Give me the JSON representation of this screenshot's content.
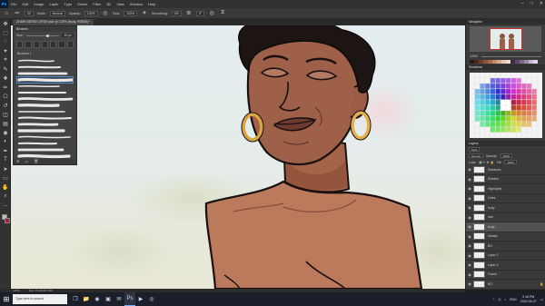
{
  "menubar": {
    "logo": "Ps",
    "items": [
      "File",
      "Edit",
      "Image",
      "Layer",
      "Type",
      "Select",
      "Filter",
      "3D",
      "View",
      "Window",
      "Help"
    ],
    "win_controls": [
      "–",
      "□",
      "✕"
    ]
  },
  "options": {
    "brush_size": "20",
    "mode_label": "Mode:",
    "mode_value": "Normal",
    "opacity_label": "Opacity:",
    "opacity_value": "100%",
    "flow_label": "Flow:",
    "flow_value": "100%",
    "smoothing_label": "Smoothing:",
    "smoothing_value": "0%",
    "angle_value": "0°"
  },
  "document": {
    "tab_title": "ZHARI DEREK ORSH.psd @ 125% (body, RGB/8) *"
  },
  "toolbar": {
    "tools": [
      "move-icon",
      "marquee-icon",
      "lasso-icon",
      "wand-icon",
      "crop-icon",
      "eyedropper-icon",
      "healing-icon",
      "brush-icon",
      "stamp-icon",
      "history-icon",
      "eraser-icon",
      "gradient-icon",
      "blur-icon",
      "dodge-icon",
      "pen-icon",
      "type-icon",
      "path-icon",
      "shape-icon",
      "hand-icon",
      "zoom-icon",
      "more-icon"
    ],
    "glyphs": [
      "✥",
      "⬚",
      "◌",
      "✦",
      "⌗",
      "✎",
      "✚",
      "✏",
      "⎔",
      "↺",
      "◫",
      "▤",
      "◉",
      "◐",
      "✒",
      "T",
      "➤",
      "▭",
      "✋",
      "⌕",
      "…"
    ],
    "fg_color": "#c9c2b4",
    "bg_color": "#a0262a"
  },
  "brushes": {
    "title": "Brushes",
    "size_label": "Size:",
    "size_value": "20 px",
    "folder": "Brushes 1",
    "footer": [
      "⊞",
      "▭",
      "🗑"
    ]
  },
  "navigator": {
    "tab": "Navigator",
    "zoom": "125%"
  },
  "swatches_tab": "Swatches",
  "layers": {
    "tab": "Layers",
    "kind": "Kind",
    "blend": "Normal",
    "opacity_label": "Opacity:",
    "opacity_value": "100%",
    "lock_label": "Lock:",
    "fill_label": "Fill:",
    "fill_value": "100%",
    "items": [
      {
        "name": "Shadows",
        "selected": false
      },
      {
        "name": "Shades",
        "selected": false
      },
      {
        "name": "Highlights",
        "selected": false
      },
      {
        "name": "Lines",
        "selected": false
      },
      {
        "name": "body",
        "selected": false
      },
      {
        "name": "hair",
        "selected": false
      },
      {
        "name": "body",
        "selected": true
      },
      {
        "name": "Details",
        "selected": false
      },
      {
        "name": "BG",
        "selected": false
      },
      {
        "name": "Layer 1",
        "selected": false
      },
      {
        "name": "Layer 2",
        "selected": false
      },
      {
        "name": "Frame",
        "selected": false
      },
      {
        "name": "BG",
        "selected": false
      }
    ]
  },
  "statusbar": {
    "zoom": "125%",
    "doc_info": "Doc: 45.2M/367.6M"
  },
  "taskbar": {
    "search_placeholder": "Type here to search",
    "time": "2:16 PM",
    "date": "2020-04-27",
    "lang": "ENG"
  }
}
